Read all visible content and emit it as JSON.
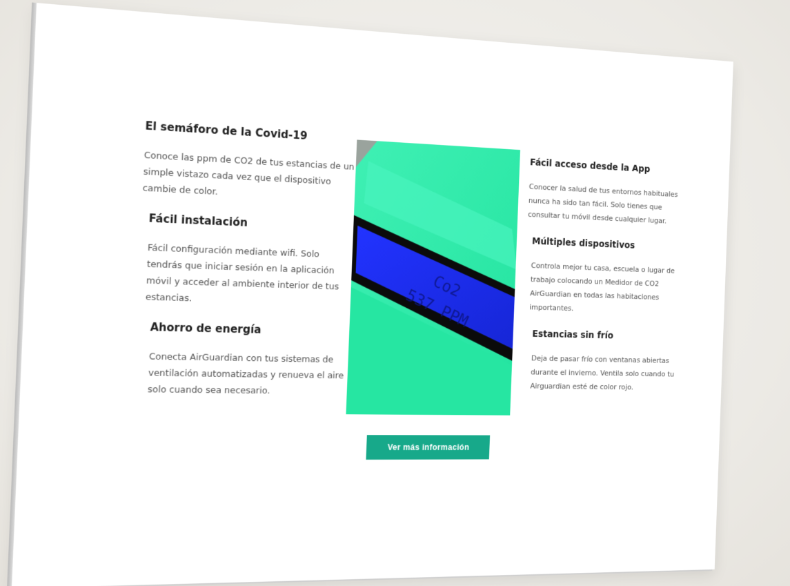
{
  "features_left": [
    {
      "title": "El semáforo de la Covid-19",
      "text": "Conoce las ppm de CO2 de tus estancias de un simple vistazo cada vez que el dispositivo cambie de color."
    },
    {
      "title": "Fácil instalación",
      "text": "Fácil configuración mediante wifi. Solo tendrás que iniciar sesión en la aplicación móvil y acceder al ambiente interior de tus estancias."
    },
    {
      "title": "Ahorro de energía",
      "text": "Conecta AirGuardian con tus sistemas de ventilación automatizadas y renueva el aire solo cuando sea necesario."
    }
  ],
  "features_right": [
    {
      "title": "Fácil acceso desde la App",
      "text": "Conocer la salud de tus entornos habituales nunca ha sido tan fácil. Solo tienes que consultar tu móvil desde cualquier lugar."
    },
    {
      "title": "Múltiples dispositivos",
      "text": "Controla mejor tu casa, escuela o lugar de trabajo colocando un Medidor de CO2 AirGuardian en todas las habitaciones importantes."
    },
    {
      "title": "Estancias sin frío",
      "text": "Deja de pasar frío con ventanas abiertas durante el invierno. Ventila solo cuando tu Airguardian esté de color rojo."
    }
  ],
  "device_display": {
    "line1": "Co2",
    "line2": "537 PPM"
  },
  "cta_label": "Ver más información",
  "colors": {
    "accent": "#17a98a",
    "device_green": "#2de8a6",
    "lcd_blue": "#1d2cf0"
  }
}
